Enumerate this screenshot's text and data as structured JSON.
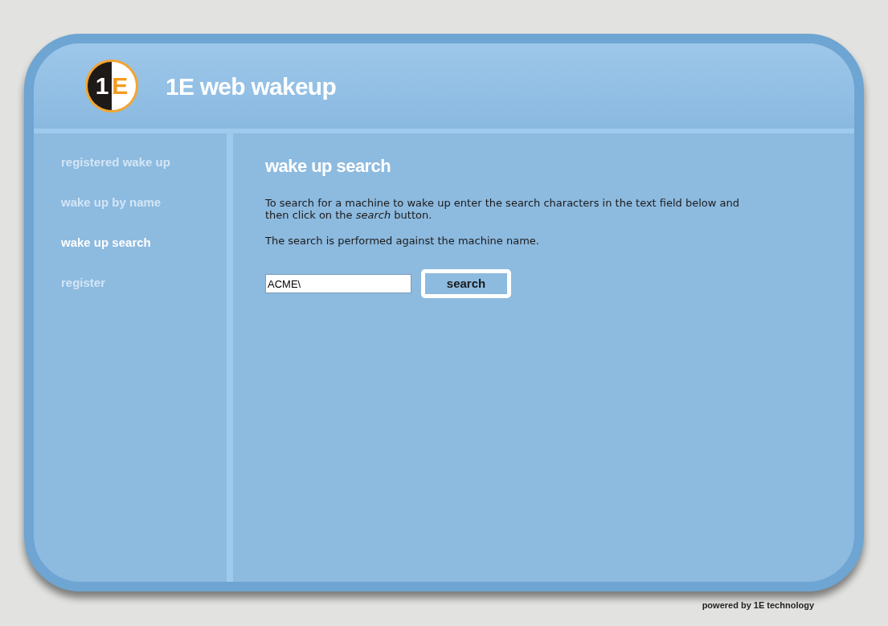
{
  "header": {
    "logo": {
      "digit": "1",
      "letter": "E"
    },
    "title": "1E web wakeup"
  },
  "sidebar": {
    "items": [
      {
        "label": "registered wake up",
        "selected": false
      },
      {
        "label": "wake up by name",
        "selected": false
      },
      {
        "label": "wake up search",
        "selected": true
      },
      {
        "label": "register",
        "selected": false
      }
    ]
  },
  "content": {
    "heading": "wake up search",
    "paragraphs": [
      "To search for a machine to wake up enter the search characters in the text field below and then click on the *search* button.",
      "The search is performed against the machine name."
    ],
    "search_field": {
      "value": "ACME\\"
    },
    "search_button": "search"
  },
  "footer": "powered by 1E technology"
}
